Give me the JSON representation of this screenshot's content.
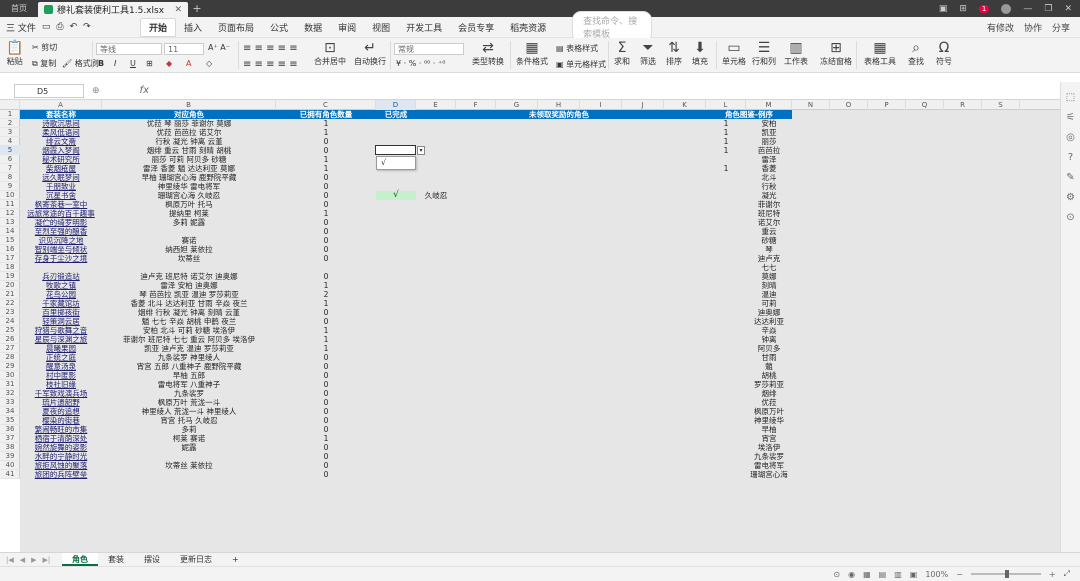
{
  "titlebar": {
    "home": "首页",
    "doc_tab": "穆礼套装便利工具1.5.xlsx",
    "plus": "+",
    "right_badge": "1",
    "right_label": "",
    "controls": [
      "—",
      "❐",
      "✕"
    ]
  },
  "menubar": {
    "file": "三 文件",
    "tabs": [
      "开始",
      "插入",
      "页面布局",
      "公式",
      "数据",
      "审阅",
      "视图",
      "开发工具",
      "会员专享",
      "稻壳资源"
    ],
    "active_tab": "开始",
    "search_placeholder": "查找命令、搜索模板",
    "right": [
      "有修改",
      "协作",
      "分享"
    ]
  },
  "ribbon": {
    "paste": "粘贴",
    "cut": "剪切",
    "copy": "复制",
    "format_painter": "格式刷",
    "font_name": "等线",
    "font_size": "11",
    "bold": "B",
    "italic": "I",
    "underline": "U",
    "merge": "合并居中",
    "wrap": "自动换行",
    "number_format": "常规",
    "type_convert": "类型转换",
    "cond_format": "条件格式",
    "table_style": "表格样式",
    "cell_style": "单元格样式",
    "sum": "求和",
    "filter": "筛选",
    "sort": "排序",
    "fill": "填充",
    "cell": "单元格",
    "row_col": "行和列",
    "worksheet": "工作表",
    "freeze": "冻结窗格",
    "table_tools": "表格工具",
    "find": "查找",
    "symbol": "符号"
  },
  "formulabar": {
    "cell_ref": "D5",
    "fx": "fx",
    "content": ""
  },
  "columns": [
    "A",
    "B",
    "C",
    "D",
    "E",
    "F",
    "G",
    "H",
    "I",
    "J",
    "K",
    "L",
    "M",
    "N",
    "O",
    "P",
    "Q",
    "R",
    "S"
  ],
  "selected_col": "D",
  "selected_row": 5,
  "header_row": {
    "a": "套装名称",
    "b": "对应角色",
    "c": "已拥有角色数量",
    "d": "已完成",
    "g": "未领取奖励的角色",
    "l": "角色图鉴-例序",
    "m": ""
  },
  "rows": [
    {
      "n": 2,
      "a": "诗歌沉思间",
      "b": "优菈 琴 丽莎 菲谢尔 莫娜",
      "c": "1",
      "l": "1",
      "m": "安柏"
    },
    {
      "n": 3,
      "a": "柔风低语间",
      "b": "优菈 芭芭拉 诺艾尔",
      "c": "1",
      "l": "1",
      "m": "凯亚"
    },
    {
      "n": 4,
      "a": "绯云文斋",
      "b": "行秋 凝光 钟离 云堇",
      "c": "0",
      "l": "1",
      "m": "丽莎"
    },
    {
      "n": 5,
      "a": "烟霞入梦阁",
      "b": "烟绯 重云 甘雨 刻晴 胡桃",
      "c": "0",
      "l": "1",
      "m": "芭芭拉"
    },
    {
      "n": 6,
      "a": "秘术研究所",
      "b": "丽莎 可莉 阿贝多 砂糖",
      "c": "1",
      "l": "",
      "m": "雷泽"
    },
    {
      "n": 7,
      "a": "柴烟疮屋",
      "b": "雷泽 香菱 魈 达达利亚 莫娜",
      "c": "1",
      "l": "1",
      "m": "香菱"
    },
    {
      "n": 8,
      "a": "远久眠梦间",
      "b": "早柚 珊瑚宫心海 鹿野院平藏",
      "c": "0",
      "l": "",
      "m": "北斗"
    },
    {
      "n": 9,
      "a": "千朋致业",
      "b": "神里绫华 雷电将军",
      "c": "0",
      "l": "",
      "m": "行秋"
    },
    {
      "n": 10,
      "a": "沉星书舍",
      "b": "珊瑚宫心海 久岐忍",
      "c": "0",
      "e": "久岐忍",
      "l": "",
      "m": "凝光"
    },
    {
      "n": 11,
      "a": "枫寄茶巷一室中",
      "b": "枫原万叶 托马",
      "c": "0",
      "l": "",
      "m": "菲谢尔"
    },
    {
      "n": 12,
      "a": "远旅常途的百千趣事",
      "b": "提纳里 柯莱",
      "c": "1",
      "l": "",
      "m": "班尼特"
    },
    {
      "n": 13,
      "a": "凝伫的绮罗明影",
      "b": "多莉 妮露",
      "c": "0",
      "l": "",
      "m": "诺艾尔"
    },
    {
      "n": 14,
      "a": "至烈至强的酿香",
      "b": "",
      "c": "0",
      "l": "",
      "m": "重云"
    },
    {
      "n": 15,
      "a": "识见沉降之地",
      "b": "赛诺",
      "c": "0",
      "l": "",
      "m": "砂糖"
    },
    {
      "n": 16,
      "a": "智别端坐与倾状",
      "b": "纳西妲 莱依拉",
      "c": "0",
      "l": "",
      "m": "琴"
    },
    {
      "n": 17,
      "a": "存身于尘沙之境",
      "b": "坎蒂丝",
      "c": "0",
      "l": "",
      "m": "迪卢克"
    },
    {
      "n": 18,
      "a": "",
      "b": "",
      "c": "",
      "l": "",
      "m": "七七"
    },
    {
      "n": 19,
      "a": "兵刃锻造站",
      "b": "迪卢克 班尼特 诺艾尔 迪奥娜",
      "c": "0",
      "l": "",
      "m": "莫娜"
    },
    {
      "n": 20,
      "a": "牧歌之镇",
      "b": "雷泽 安柏 迪奥娜",
      "c": "1",
      "l": "",
      "m": "刻晴"
    },
    {
      "n": 21,
      "a": "花鸟公园",
      "b": "琴 芭芭拉 凯亚 温迪 罗莎莉亚",
      "c": "2",
      "l": "",
      "m": "温迪"
    },
    {
      "n": 22,
      "a": "千家藏馆坊",
      "b": "香菱 北斗 达达利亚 甘雨 辛焱 夜兰",
      "c": "1",
      "l": "",
      "m": "可莉"
    },
    {
      "n": 23,
      "a": "百里掷孩街",
      "b": "烟绯 行秋 凝光 钟离 刻晴 云堇",
      "c": "0",
      "l": "",
      "m": "迪奥娜"
    },
    {
      "n": 24,
      "a": "轻策洞云居",
      "b": "魈 七七 辛焱 胡桃 申鹤 夜兰",
      "c": "0",
      "l": "",
      "m": "达达利亚"
    },
    {
      "n": 25,
      "a": "狩猎与歌舞之音",
      "b": "安柏 北斗 可莉 砂糖 埃洛伊",
      "c": "1",
      "l": "",
      "m": "辛焱"
    },
    {
      "n": 26,
      "a": "星辰与深渊之旅",
      "b": "菲谢尔 班尼特 七七 重云 阿贝多 埃洛伊",
      "c": "1",
      "l": "",
      "m": "钟离"
    },
    {
      "n": 27,
      "a": "晨曦果园",
      "b": "凯亚 迪卢克 温迪 罗莎莉亚",
      "c": "1",
      "l": "",
      "m": "阿贝多"
    },
    {
      "n": 28,
      "a": "正统之庭",
      "b": "九条裟罗 神里绫人",
      "c": "0",
      "l": "",
      "m": "甘雨"
    },
    {
      "n": 29,
      "a": "醒意汤泉",
      "b": "宵宫 五郎 八重神子 鹿野院平藏",
      "c": "0",
      "l": "",
      "m": "魈"
    },
    {
      "n": 30,
      "a": "村中匿影",
      "b": "早柚 五郎",
      "c": "0",
      "l": "",
      "m": "胡桃"
    },
    {
      "n": 31,
      "a": "枝社旧缘",
      "b": "雷电将军 八重神子",
      "c": "0",
      "l": "",
      "m": "罗莎莉亚"
    },
    {
      "n": 32,
      "a": "千军致戏演兵场",
      "b": "九条裟罗",
      "c": "0",
      "l": "",
      "m": "烟绯"
    },
    {
      "n": 33,
      "a": "琉片遗韶野",
      "b": "枫原万叶 荒泷一斗",
      "c": "0",
      "l": "",
      "m": "优菈"
    },
    {
      "n": 34,
      "a": "夏夜的追想",
      "b": "神里绫人 荒泷一斗 神里绫人",
      "c": "0",
      "l": "",
      "m": "枫原万叶"
    },
    {
      "n": 35,
      "a": "樱染的街巷",
      "b": "宵宫 托马 久岐忍",
      "c": "0",
      "l": "",
      "m": "神里绫华"
    },
    {
      "n": 36,
      "a": "繁闹畅旺的市集",
      "b": "多莉",
      "c": "0",
      "l": "",
      "m": "早柚"
    },
    {
      "n": 37,
      "a": "栖宿于清荫深处",
      "b": "柯莱 赛诺",
      "c": "1",
      "l": "",
      "m": "宵宫"
    },
    {
      "n": 38,
      "a": "婉然旋舞的姿影",
      "b": "妮露",
      "c": "0",
      "l": "",
      "m": "埃洛伊"
    },
    {
      "n": 39,
      "a": "水畔的宁静时光",
      "b": "",
      "c": "0",
      "l": "",
      "m": "九条裟罗"
    },
    {
      "n": 40,
      "a": "旅拒风蚀的聚落",
      "b": "坎蒂丝 莱依拉",
      "c": "0",
      "l": "",
      "m": "雷电将军"
    },
    {
      "n": 41,
      "a": "旅团的兵阵壁垒",
      "b": "",
      "c": "0",
      "l": "",
      "m": "珊瑚宫心海"
    }
  ],
  "green_cell": {
    "row": 10,
    "value": "√"
  },
  "dropdown": {
    "row": 5,
    "option": "√",
    "arrow": "▾"
  },
  "sheets": [
    "角色",
    "套装",
    "摆设",
    "更新日志"
  ],
  "active_sheet": "角色",
  "status": {
    "zoom": "100%"
  }
}
